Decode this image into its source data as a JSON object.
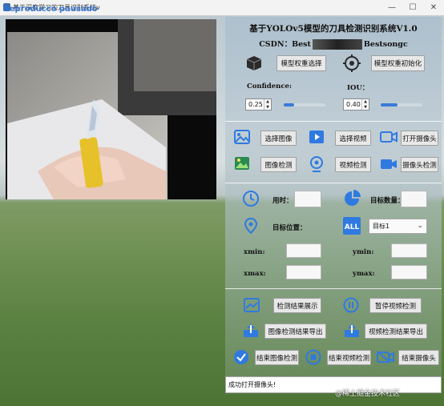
{
  "window": {
    "title": "基于深度学习的刀具识别系统v",
    "overlay_text": "Reproducco pausado",
    "buttons": [
      "—",
      "☐",
      "✕"
    ]
  },
  "header": {
    "title": "基于YOLOv5模型的刀具检测识别系统V1.0",
    "csdn_label": "CSDN：",
    "csdn_left": "Best",
    "csdn_right": "Bestsongc"
  },
  "model": {
    "select_label": "模型权重选择",
    "init_label": "模型权重初始化"
  },
  "params": {
    "confidence_label": "Confidence:",
    "confidence_value": "0.25",
    "confidence_level": 0.25,
    "iou_label": "IOU：",
    "iou_value": "0.40",
    "iou_level": 0.4
  },
  "actions": {
    "select_image": "选择图像",
    "select_video": "选择视频",
    "open_camera": "打开摄像头",
    "detect_image": "图像检测",
    "detect_video": "视频检测",
    "detect_camera": "摄像头检测"
  },
  "results": {
    "time_label": "用时：",
    "count_label": "目标数量：",
    "position_label": "目标位置：",
    "target_select": "目标1",
    "xmin_label": "xmin:",
    "ymin_label": "ymin:",
    "xmax_label": "xmax:",
    "ymax_label": "ymax:"
  },
  "controls": {
    "show_result": "检测结果展示",
    "pause_video": "暂停视频检测",
    "export_image": "图像检测结果导出",
    "export_video": "视频检测结果导出",
    "end_image": "结束图像检测",
    "end_video": "结束视频检测",
    "end_camera": "结束摄像头"
  },
  "status": {
    "message": "成功打开摄像头!"
  },
  "watermark": "@稀土掘金技术社区",
  "colors": {
    "accent": "#2f7ae0",
    "button_bg": "#e8e8e8"
  }
}
